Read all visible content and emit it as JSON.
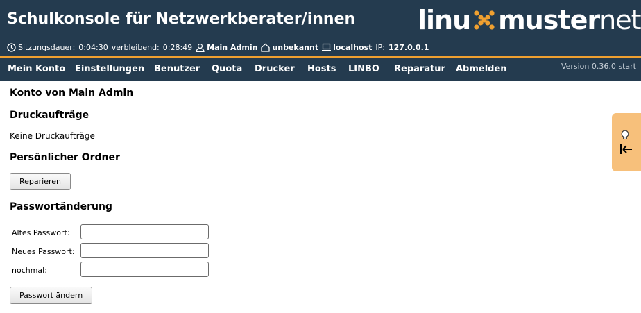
{
  "header": {
    "title": "Schulkonsole für Netzwerkberater/innen",
    "logo": {
      "left": "linu",
      "mid": "muster",
      "right": "net"
    },
    "session": {
      "duration_label": "Sitzungsdauer:",
      "duration_value": "0:04:30",
      "remaining_label": "verbleibend:",
      "remaining_value": "0:28:49",
      "user": "Main Admin",
      "room": "unbekannt",
      "host": "localhost",
      "ip_label": "IP:",
      "ip_value": "127.0.0.1"
    }
  },
  "nav": {
    "items": [
      "Mein Konto",
      "Einstellungen",
      "Benutzer",
      "Quota",
      "Drucker",
      "Hosts",
      "LINBO",
      "Reparatur",
      "Abmelden"
    ],
    "version": "Version 0.36.0 start"
  },
  "main": {
    "account_heading": "Konto von Main Admin",
    "print_jobs_heading": "Druckaufträge",
    "print_jobs_empty": "Keine Druckaufträge",
    "folder_heading": "Persönlicher Ordner",
    "repair_button": "Reparieren",
    "password_heading": "Passwortänderung",
    "old_password_label": "Altes Passwort:",
    "new_password_label": "Neues Passwort:",
    "repeat_password_label": "nochmal:",
    "change_password_button": "Passwort ändern"
  },
  "help_tab": {
    "icons": [
      "lightbulb-icon",
      "arrow-left-bar-icon"
    ]
  },
  "colors": {
    "header_bg": "#243b4f",
    "accent": "#f0a030",
    "help_tab": "#f7c07b"
  }
}
